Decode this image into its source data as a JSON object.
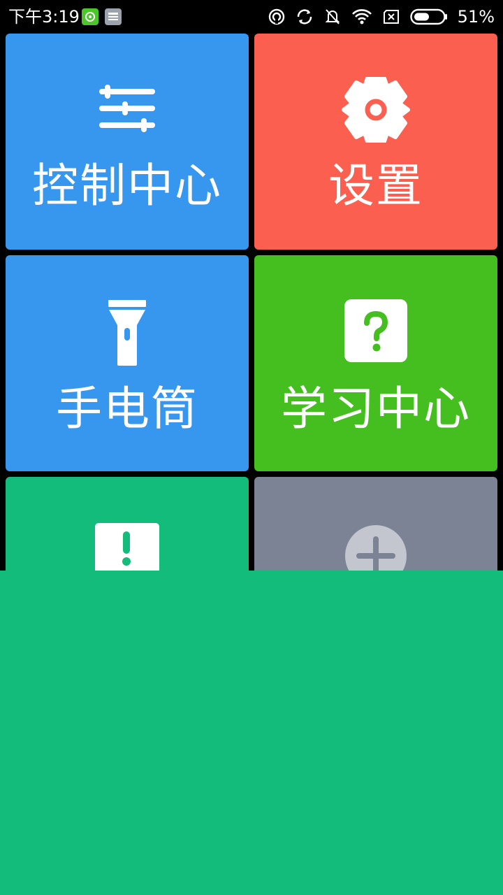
{
  "status_bar": {
    "time": "下午3:19",
    "battery_percent": "51%",
    "icons_left": [
      "app-notification-icon",
      "message-icon"
    ],
    "icons_right": [
      "hotspot-icon",
      "sync-icon",
      "mute-bell-icon",
      "wifi-icon",
      "no-sim-icon",
      "battery-icon"
    ]
  },
  "tiles": [
    {
      "label": "控制中心",
      "icon": "sliders-icon",
      "color": "#3797EF"
    },
    {
      "label": "设置",
      "icon": "gear-icon",
      "color": "#FB5F4F"
    },
    {
      "label": "手电筒",
      "icon": "flashlight-icon",
      "color": "#3797EF"
    },
    {
      "label": "学习中心",
      "icon": "help-icon",
      "color": "#45BE1F"
    },
    {
      "label": "",
      "icon": "feedback-icon",
      "color": "#14BC7B"
    },
    {
      "label": "",
      "icon": "add-icon",
      "color": "#7B8395"
    }
  ],
  "overlay_color": "#14BC7B"
}
